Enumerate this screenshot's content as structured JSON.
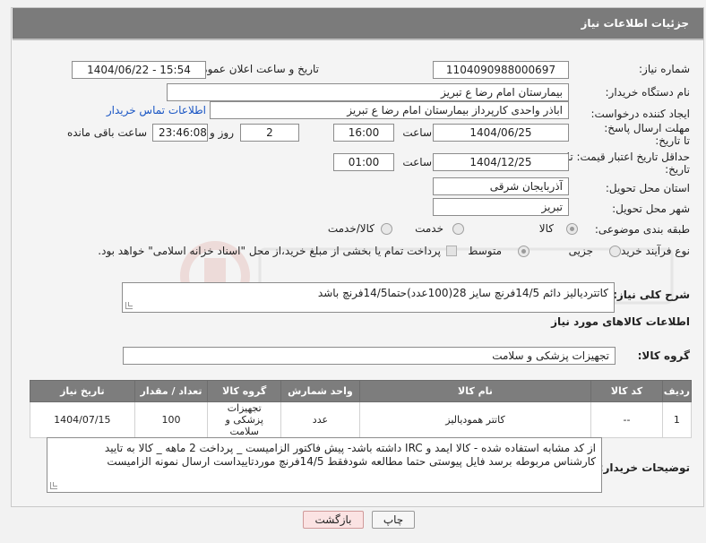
{
  "header": {
    "title": "جزئیات اطلاعات نیاز"
  },
  "fields": {
    "need_number_label": "شماره نیاز:",
    "need_number": "1104090988000697",
    "announce_label": "تاریخ و ساعت اعلان عمومی:",
    "announce_value": "1404/06/22 - 15:54",
    "buyer_org_label": "نام دستگاه خریدار:",
    "buyer_org": "بیمارستان امام رضا  ع  تبریز",
    "creator_label": "ایجاد کننده درخواست:",
    "creator": "اباذر واحدی کارپرداز بیمارستان امام رضا  ع  تبریز",
    "contact_link": "اطلاعات تماس خریدار",
    "deadline_label": "مهلت ارسال پاسخ: تا تاریخ:",
    "deadline_date": "1404/06/25",
    "time_word": "ساعت",
    "deadline_time": "16:00",
    "days_value": "2",
    "days_word": "روز و",
    "remaining_time": "23:46:08",
    "remaining_word": "ساعت باقی مانده",
    "min_valid_label": "حداقل تاریخ اعتبار قیمت: تا تاریخ:",
    "min_valid_date": "1404/12/25",
    "min_valid_time": "01:00",
    "province_label": "استان محل تحویل:",
    "province": "آذربایجان شرقی",
    "city_label": "شهر محل تحویل:",
    "city": "تبریز",
    "category_label": "طبقه بندی موضوعی:",
    "category_options": [
      "کالا",
      "خدمت",
      "کالا/خدمت"
    ],
    "process_label": "نوع فرآیند خرید :",
    "process_options": [
      "جزیی",
      "متوسط"
    ],
    "payment_note": "پرداخت تمام یا بخشی از مبلغ خرید،از محل \"اسناد خزانه اسلامی\" خواهد بود."
  },
  "summary": {
    "label": "شرح کلی نیاز:",
    "text": "کاتتردیالیز دائم 14/5فرنچ سایز 28(100عدد)حتما14/5فرنچ باشد"
  },
  "goods": {
    "section_title": "اطلاعات کالاهای مورد نیاز",
    "group_label": "گروه کالا:",
    "group_value": "تجهیزات پزشکی و سلامت",
    "columns": [
      "ردیف",
      "کد کالا",
      "نام کالا",
      "واحد شمارش",
      "گروه کالا",
      "تعداد / مقدار",
      "تاریخ نیاز"
    ],
    "rows": [
      {
        "row": "1",
        "code": "--",
        "name": "کاتتر همودیالیز",
        "unit": "عدد",
        "group": "تجهیزات پزشکی و سلامت",
        "qty": "100",
        "date": "1404/07/15"
      }
    ]
  },
  "buyer_notes": {
    "label": "توضیحات خریدار:",
    "line1": "از کد مشابه استفاده شده - کالا ایمد و IRC داشته باشد- پیش فاکتور الزامیست _ پرداخت 2 ماهه _ کالا به تایید",
    "line2": "کارشناس مربوطه برسد فایل پیوستی حتما مطالعه شودفقط 14/5فرنچ موردتاییداست ارسال نمونه الزامیست"
  },
  "buttons": {
    "print": "چاپ",
    "back": "بازگشت"
  },
  "colors": {
    "header_bg": "#7b7b7b",
    "link": "#1a56c4",
    "back_btn_bg": "#fbe3e3"
  }
}
